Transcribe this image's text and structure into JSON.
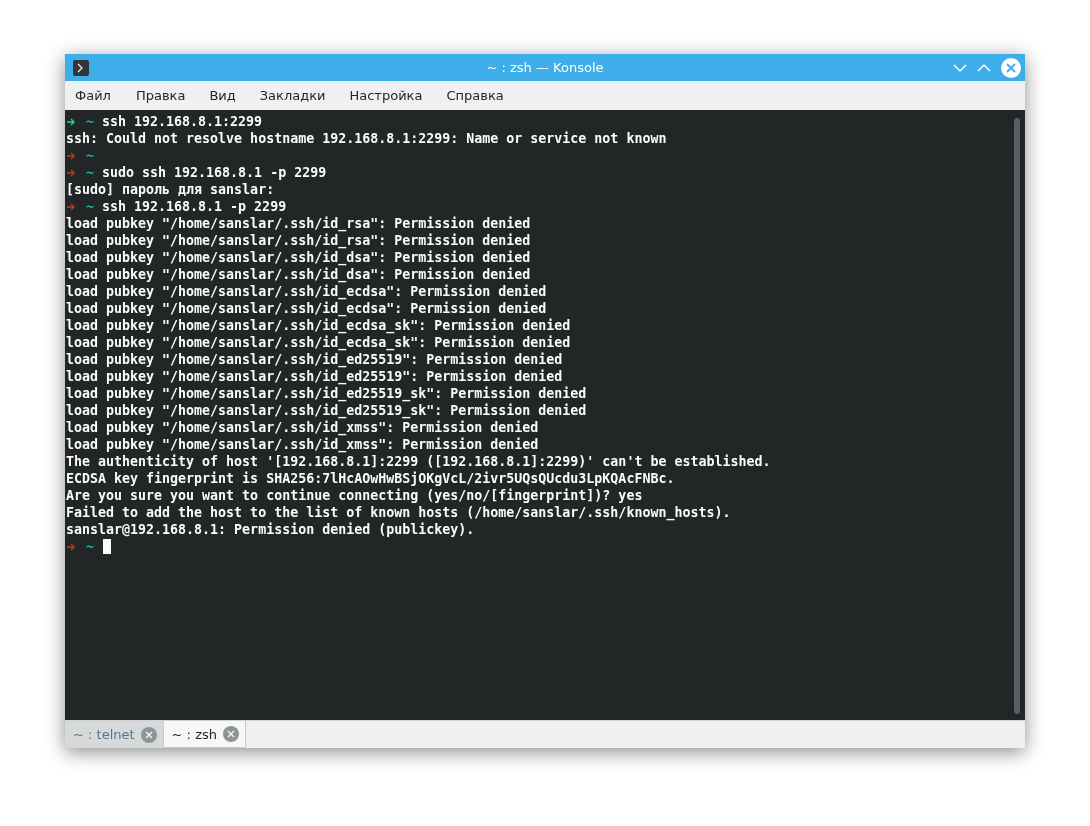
{
  "window": {
    "title": "~ : zsh — Konsole"
  },
  "menu": [
    "Файл",
    "Правка",
    "Вид",
    "Закладки",
    "Настройка",
    "Справка"
  ],
  "terminal": {
    "lines": [
      {
        "kind": "prompt",
        "color": "#1cdc9a",
        "dir": "~",
        "command": "ssh 192.168.8.1:2299"
      },
      {
        "kind": "output",
        "text": "ssh: Could not resolve hostname 192.168.8.1:2299: Name or service not known"
      },
      {
        "kind": "prompt",
        "color": "#c0392b",
        "dir": "~"
      },
      {
        "kind": "prompt",
        "color": "#c0392b",
        "dir": "~",
        "command": "sudo ssh 192.168.8.1 -p 2299"
      },
      {
        "kind": "output",
        "text": "[sudo] пароль для sanslar:"
      },
      {
        "kind": "prompt",
        "color": "#c0392b",
        "dir": "~",
        "command": "ssh 192.168.8.1 -p 2299"
      },
      {
        "kind": "output",
        "text": "load pubkey \"/home/sanslar/.ssh/id_rsa\": Permission denied"
      },
      {
        "kind": "output",
        "text": "load pubkey \"/home/sanslar/.ssh/id_rsa\": Permission denied"
      },
      {
        "kind": "output",
        "text": "load pubkey \"/home/sanslar/.ssh/id_dsa\": Permission denied"
      },
      {
        "kind": "output",
        "text": "load pubkey \"/home/sanslar/.ssh/id_dsa\": Permission denied"
      },
      {
        "kind": "output",
        "text": "load pubkey \"/home/sanslar/.ssh/id_ecdsa\": Permission denied"
      },
      {
        "kind": "output",
        "text": "load pubkey \"/home/sanslar/.ssh/id_ecdsa\": Permission denied"
      },
      {
        "kind": "output",
        "text": "load pubkey \"/home/sanslar/.ssh/id_ecdsa_sk\": Permission denied"
      },
      {
        "kind": "output",
        "text": "load pubkey \"/home/sanslar/.ssh/id_ecdsa_sk\": Permission denied"
      },
      {
        "kind": "output",
        "text": "load pubkey \"/home/sanslar/.ssh/id_ed25519\": Permission denied"
      },
      {
        "kind": "output",
        "text": "load pubkey \"/home/sanslar/.ssh/id_ed25519\": Permission denied"
      },
      {
        "kind": "output",
        "text": "load pubkey \"/home/sanslar/.ssh/id_ed25519_sk\": Permission denied"
      },
      {
        "kind": "output",
        "text": "load pubkey \"/home/sanslar/.ssh/id_ed25519_sk\": Permission denied"
      },
      {
        "kind": "output",
        "text": "load pubkey \"/home/sanslar/.ssh/id_xmss\": Permission denied"
      },
      {
        "kind": "output",
        "text": "load pubkey \"/home/sanslar/.ssh/id_xmss\": Permission denied"
      },
      {
        "kind": "output",
        "text": "The authenticity of host '[192.168.8.1]:2299 ([192.168.8.1]:2299)' can't be established."
      },
      {
        "kind": "output",
        "text": "ECDSA key fingerprint is SHA256:7lHcAOwHwBSjOKgVcL/2ivr5UQsQUcdu3LpKQAcFNBc."
      },
      {
        "kind": "output",
        "text": "Are you sure you want to continue connecting (yes/no/[fingerprint])? yes"
      },
      {
        "kind": "output",
        "text": "Failed to add the host to the list of known hosts (/home/sanslar/.ssh/known_hosts)."
      },
      {
        "kind": "output",
        "text": "sanslar@192.168.8.1: Permission denied (publickey)."
      },
      {
        "kind": "prompt",
        "color": "#c0392b",
        "dir": "~",
        "cursor": true
      }
    ]
  },
  "tabs": [
    {
      "label": "~ : telnet",
      "selected": false
    },
    {
      "label": "~ : zsh",
      "selected": true
    }
  ]
}
